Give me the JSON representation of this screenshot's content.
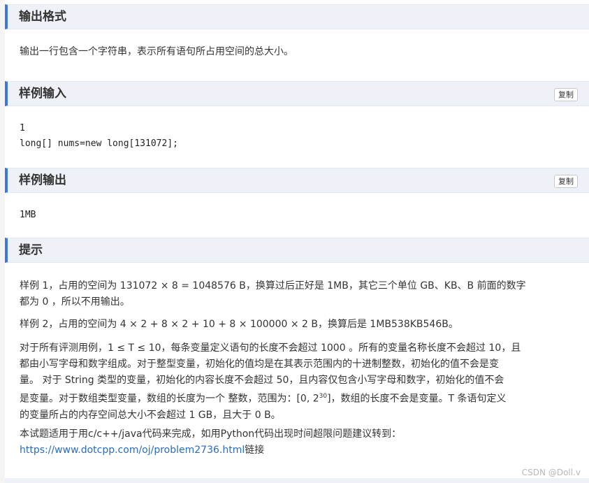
{
  "sections": {
    "output_format": {
      "title": "输出格式",
      "text": "输出一行包含一个字符串，表示所有语句所占用空间的总大小。"
    },
    "sample_input": {
      "title": "样例输入",
      "copy": "复制",
      "lines": [
        "1",
        "long[] nums=new long[131072];"
      ]
    },
    "sample_output": {
      "title": "样例输出",
      "copy": "复制",
      "text": "1MB"
    },
    "hint": {
      "title": "提示",
      "p1_line1": "样例 1，占用的空间为 131072 × 8 = 1048576 B，换算过后正好是 1MB，其它三个单位 GB、KB、B 前面的数字",
      "p1_line2": "都为 0 ，所以不用输出。",
      "p2": "样例 2，占用的空间为 4 × 2 + 8 × 2 + 10 + 8 × 100000 × 2 B，换算后是 1MB538KB546B。",
      "p3_line1": "对于所有评测用例，1 ≤ T ≤ 10，每条变量定义语句的长度不会超过 1000 。所有的变量名称长度不会超过 10，且",
      "p3_line2": "都由小写字母和数字组成。对于整型变量，初始化的值均是在其表示范围内的十进制整数，初始化的值不会是变",
      "p3_line3": "量。 对于 String 类型的变量，初始化的内容长度不会超过 50，且内容仅包含小写字母和数字，初始化的值不会",
      "p3_line4_a": "是变量。对于数组类型变量，数组的长度为一个 整数，范围为：[0, 2",
      "p3_line4_sup": "30",
      "p3_line4_b": "]，数组的长度不会是变量。T 条语句定义",
      "p3_line5": "的变量所占的内存空间总大小不会超过 1 GB，且大于 0 B。",
      "p4_line1": "本试题适用于用c/c++/java代码来完成，如用Python代码出现时间超限问题建议转到：",
      "p4_link": "https://www.dotcpp.com/oj/problem2736.html",
      "p4_suffix": "链接"
    }
  },
  "watermark": "CSDN @Doll.v",
  "colors": {
    "accent": "#3c78d8",
    "header_bg": "#eef1f7",
    "link": "#2a6db8"
  }
}
